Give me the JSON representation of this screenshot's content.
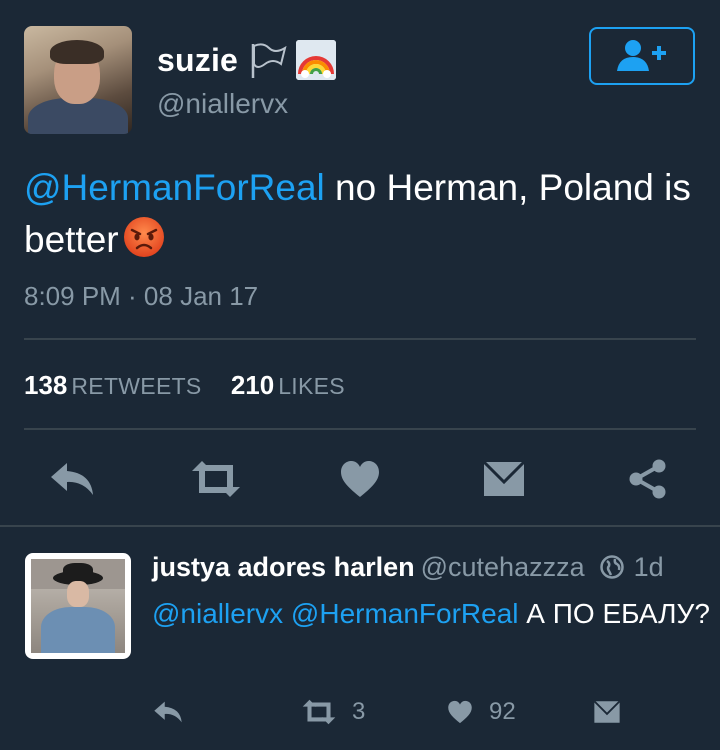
{
  "tweet": {
    "display_name": "suzie",
    "handle": "@niallervx",
    "mention": "@HermanForReal",
    "text": " no Herman, Poland is better",
    "emoji": "angry-face-emoji",
    "timestamp": "8:09 PM · 08 Jan 17",
    "retweets_count": "138",
    "retweets_label": "RETWEETS",
    "likes_count": "210",
    "likes_label": "LIKES"
  },
  "actions": {
    "icons": [
      "reply-icon",
      "retweet-icon",
      "like-icon",
      "dm-icon",
      "share-icon"
    ]
  },
  "reply": {
    "display_name": "justya adores harlen",
    "handle": "@cutehazzza",
    "time": "1d",
    "mention1": "@niallervx",
    "mention2": "@HermanForReal",
    "text": " А ПО ЕБАЛУ?",
    "retweet_count": "3",
    "like_count": "92"
  },
  "colors": {
    "background": "#1b2836",
    "accent": "#1da1f2",
    "secondary_text": "#8899a6",
    "divider": "#38444d",
    "icon": "#8899a6"
  }
}
